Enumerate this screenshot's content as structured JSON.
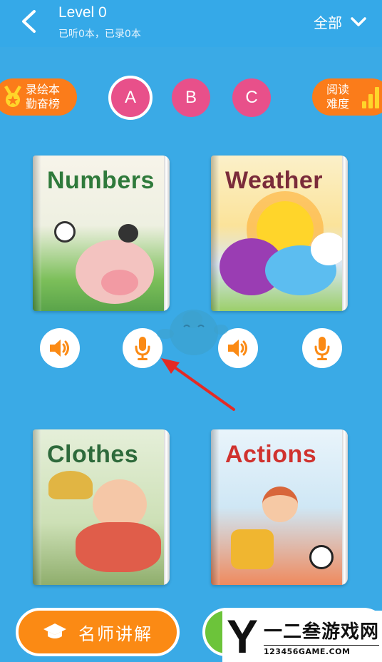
{
  "header": {
    "title": "Level 0",
    "subtitle": "已听0本，已录0本",
    "filter_label": "全部"
  },
  "badges": {
    "leaderboard": [
      "录绘本",
      "勤奋榜"
    ],
    "difficulty": [
      "阅读",
      "难度"
    ]
  },
  "level_tabs": [
    {
      "label": "A",
      "active": true
    },
    {
      "label": "B",
      "active": false
    },
    {
      "label": "C",
      "active": false
    }
  ],
  "books": [
    {
      "title": "Numbers"
    },
    {
      "title": "Weather"
    },
    {
      "title": "Clothes"
    },
    {
      "title": "Actions"
    }
  ],
  "bottom": {
    "teacher_label": "名师讲解"
  },
  "watermark": {
    "letter": "Y",
    "name": "一二叁游戏网",
    "url": "123456GAME.COM"
  },
  "colors": {
    "background": "#3aaae6",
    "accent_orange": "#fb7c1a",
    "tab_pink": "#e8508a",
    "green": "#6cc43a"
  }
}
